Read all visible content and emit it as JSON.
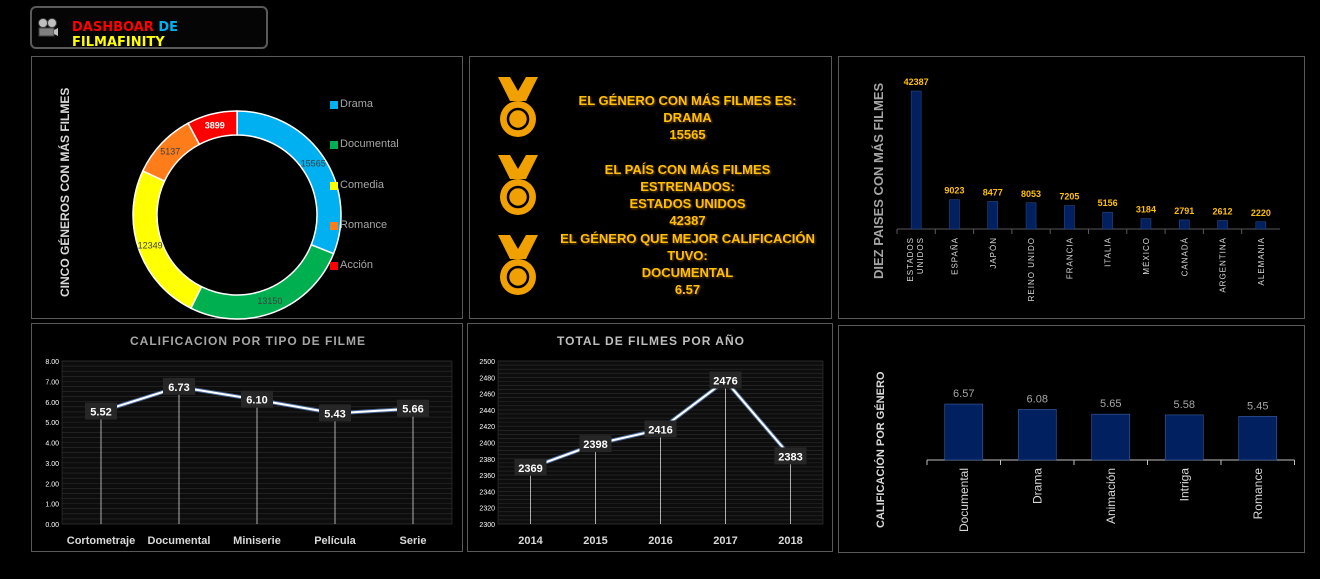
{
  "header": {
    "title_part1": "DASHBOAR",
    "title_part2": "DE",
    "title_part3": "FILMAFINITY",
    "icon": "film-projector-icon"
  },
  "colors": {
    "accent_gold": "#ffc000",
    "bar_navy": "#002060",
    "background": "#000000"
  },
  "genres_panel": {
    "ylabel": "CINCO GÉNEROS CON MÁS  FILMES",
    "legend": [
      "Drama",
      "Documental",
      "Comedia",
      "Romance",
      "Acción"
    ]
  },
  "highlights": {
    "icon": "medal-icon",
    "item1": {
      "line1": "EL GÉNERO CON MÁS FILMES ES:",
      "line2": "DRAMA",
      "line3": "15565"
    },
    "item2": {
      "line1": "EL PAÍS CON MÁS FILMES ESTRENADOS:",
      "line2": "ESTADOS UNIDOS",
      "line3": "42387"
    },
    "item3": {
      "line1": "EL GÉNERO QUE MEJOR CALIFICACIÓN",
      "line2": "TUVO:",
      "line3": "DOCUMENTAL",
      "line4": "6.57"
    }
  },
  "countries_panel": {
    "ylabel": "DIEZ PAISES CON MÁS FILMES"
  },
  "type_panel": {
    "title": "CALIFICACION POR TIPO DE FILME"
  },
  "year_panel": {
    "title": "TOTAL DE FILMES POR AÑO"
  },
  "genre_rating_panel": {
    "ylabel": "CALIFICACIÓN POR GÉNERO"
  },
  "chart_data": [
    {
      "type": "pie",
      "donut": true,
      "categories": [
        "Drama",
        "Documental",
        "Comedia",
        "Romance",
        "Acción"
      ],
      "values": [
        15565,
        13150,
        12349,
        5137,
        3899
      ],
      "colors": [
        "#00b0f0",
        "#00b050",
        "#ffff00",
        "#ff7c1a",
        "#ff0000"
      ],
      "legend_position": "right"
    },
    {
      "type": "bar",
      "categories": [
        "ESTADOS UNIDOS",
        "ESPAÑA",
        "JAPÓN",
        "REINO UNIDO",
        "FRANCIA",
        "ITALIA",
        "MÉXICO",
        "CANADÁ",
        "ARGENTINA",
        "ALEMANIA"
      ],
      "values": [
        42387,
        9023,
        8477,
        8053,
        7205,
        5156,
        3184,
        2791,
        2612,
        2220
      ],
      "ylabel": "DIEZ PAISES CON MÁS FILMES",
      "ylim": [
        0,
        45000
      ]
    },
    {
      "type": "line",
      "title": "CALIFICACION POR TIPO DE FILME",
      "categories": [
        "Cortometraje",
        "Documental",
        "Miniserie",
        "Película",
        "Serie"
      ],
      "values": [
        5.52,
        6.73,
        6.1,
        5.43,
        5.66
      ],
      "ylim": [
        0,
        8
      ],
      "yticks": [
        "0.00",
        "1.00",
        "2.00",
        "3.00",
        "4.00",
        "5.00",
        "6.00",
        "7.00",
        "8.00"
      ],
      "grid": true
    },
    {
      "type": "line",
      "title": "TOTAL DE FILMES POR AÑO",
      "categories": [
        "2014",
        "2015",
        "2016",
        "2017",
        "2018"
      ],
      "values": [
        2369,
        2398,
        2416,
        2476,
        2383
      ],
      "ylim": [
        2300,
        2500
      ],
      "yticks": [
        "2300",
        "2320",
        "2340",
        "2360",
        "2380",
        "2400",
        "2420",
        "2440",
        "2460",
        "2480",
        "2500"
      ],
      "grid": true
    },
    {
      "type": "bar",
      "categories": [
        "Documental",
        "Drama",
        "Animación",
        "Intriga",
        "Romance"
      ],
      "values": [
        6.57,
        6.08,
        5.65,
        5.58,
        5.45
      ],
      "labels": [
        "6.57",
        "6.08",
        "5.65",
        "5.58",
        "5.45"
      ],
      "ylabel": "CALIFICACIÓN POR GÉNERO"
    }
  ]
}
